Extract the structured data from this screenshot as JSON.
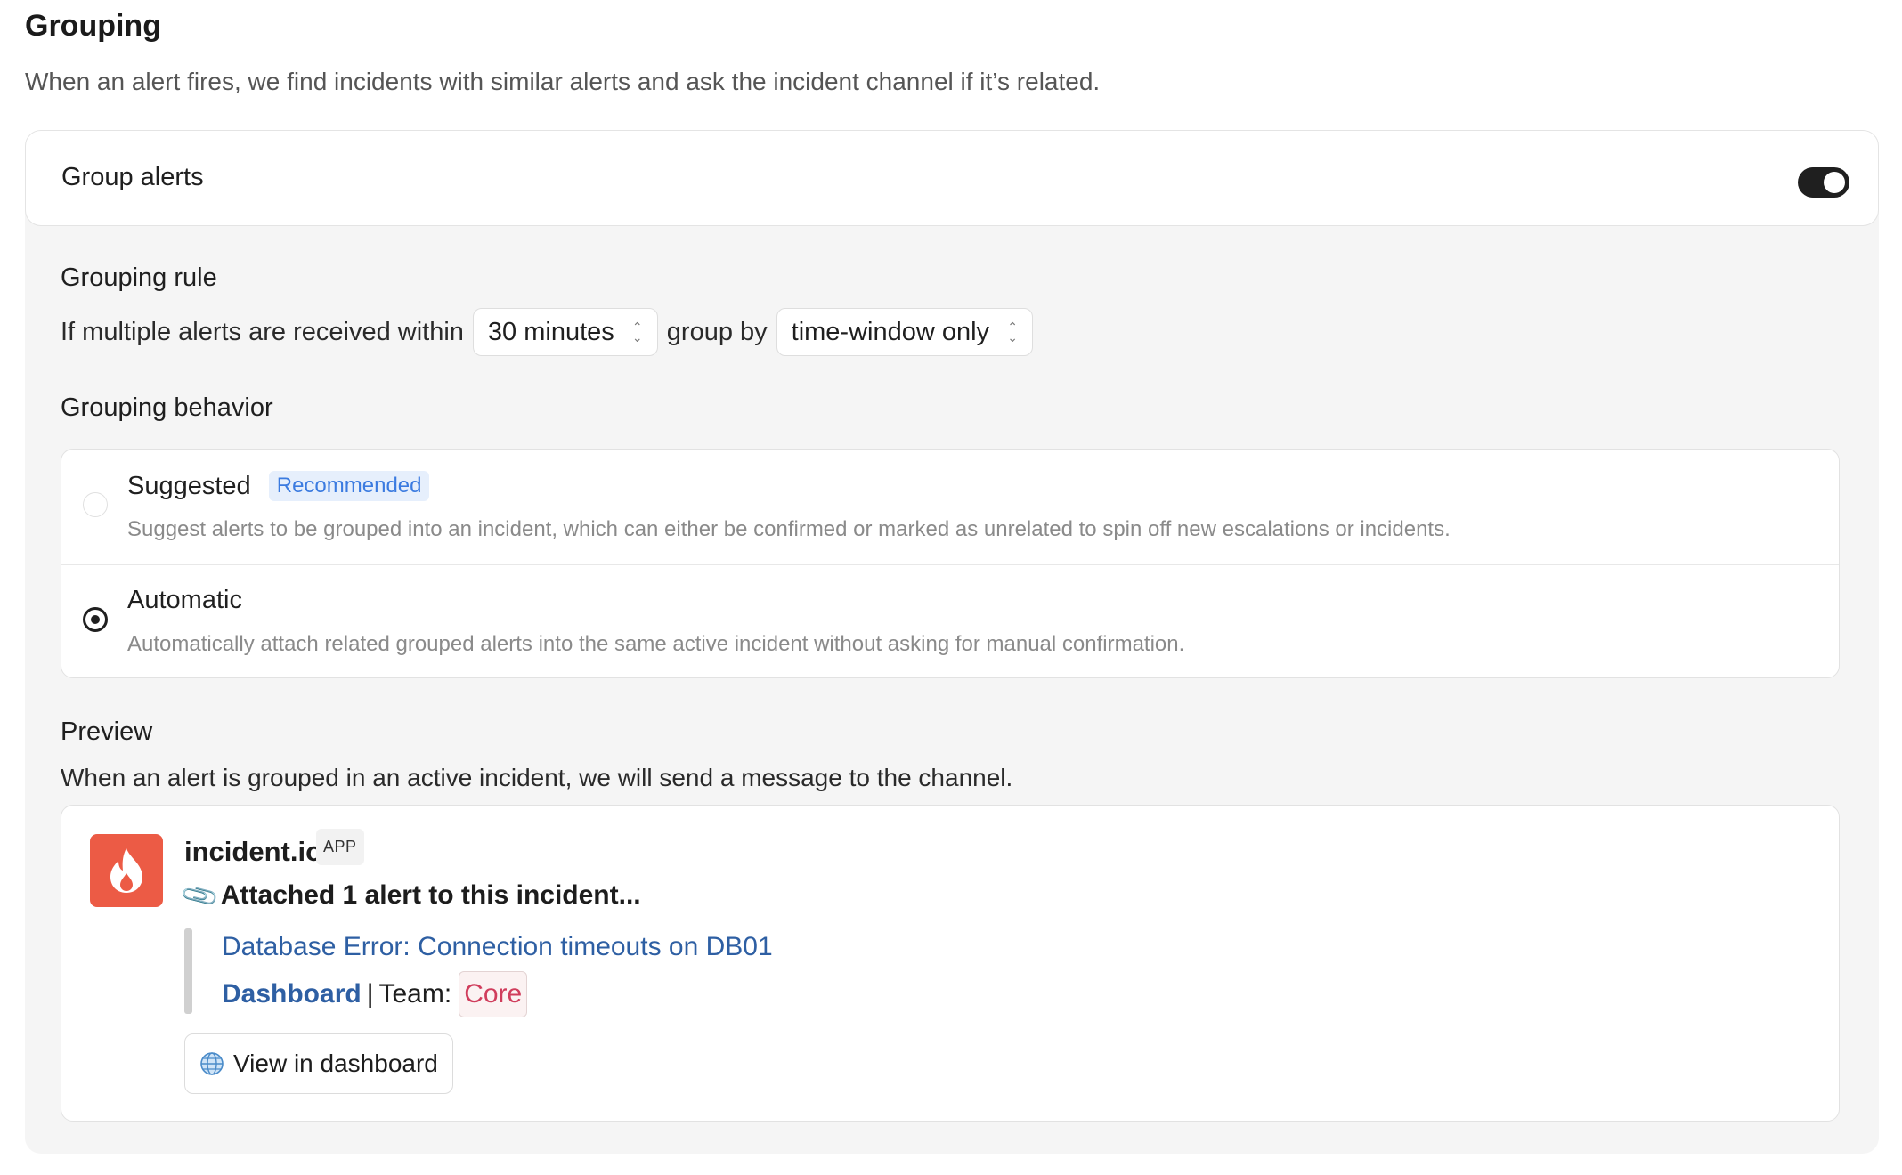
{
  "section": {
    "title": "Grouping",
    "description": "When an alert fires, we find incidents with similar alerts and ask the incident channel if it’s related."
  },
  "group_alerts": {
    "label": "Group alerts",
    "enabled": true
  },
  "grouping_rule": {
    "title": "Grouping rule",
    "prefix": "If multiple alerts are received within",
    "window_value": "30 minutes",
    "middle": "group by",
    "group_by_value": "time-window only"
  },
  "grouping_behavior": {
    "title": "Grouping behavior",
    "options": [
      {
        "title": "Suggested",
        "badge": "Recommended",
        "description": "Suggest alerts to be grouped into an incident, which can either be confirmed or marked as unrelated to spin off new escalations or incidents.",
        "selected": false
      },
      {
        "title": "Automatic",
        "description": "Automatically attach related grouped alerts into the same active incident without asking for manual confirmation.",
        "selected": true
      }
    ]
  },
  "preview": {
    "title": "Preview",
    "description": "When an alert is grouped in an active incident, we will send a message to the channel.",
    "app_name": "incident.io",
    "app_tag": "APP",
    "logo_icon": "flame-icon",
    "message": "Attached 1 alert to this incident...",
    "alert_title": "Database Error: Connection timeouts on DB01",
    "dashboard_link": "Dashboard",
    "team_label": "Team:",
    "team_value": "Core",
    "view_button": "View in dashboard"
  },
  "colors": {
    "brand": "#ec5b45",
    "link": "#2e5fa3",
    "badge": "#3b7be0",
    "team": "#d03d5c"
  }
}
